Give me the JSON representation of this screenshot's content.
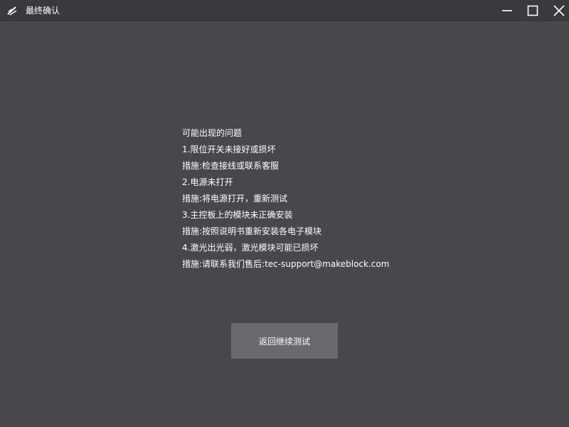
{
  "window": {
    "title": "最终确认",
    "icon": "app-logo-icon",
    "controls": {
      "minimize_icon": "minimize-icon",
      "maximize_icon": "maximize-icon",
      "close_icon": "close-icon"
    }
  },
  "message": {
    "lines": [
      "可能出现的问题",
      "1.限位开关未接好或损坏",
      "措施:检查接线或联系客服",
      "2.电源未打开",
      "措施:将电源打开，重新测试",
      "3.主控板上的模块未正确安装",
      "措施:按照说明书重新安装各电子模块",
      "4.激光出光弱，激光模块可能已损坏",
      "措施:请联系我们售后:tec-support@makeblock.com"
    ]
  },
  "actions": {
    "return_label": "返回继续测试"
  },
  "colors": {
    "background": "#48474c",
    "titlebar": "#3a393e",
    "button": "#6a696d",
    "text": "#ffffff"
  }
}
